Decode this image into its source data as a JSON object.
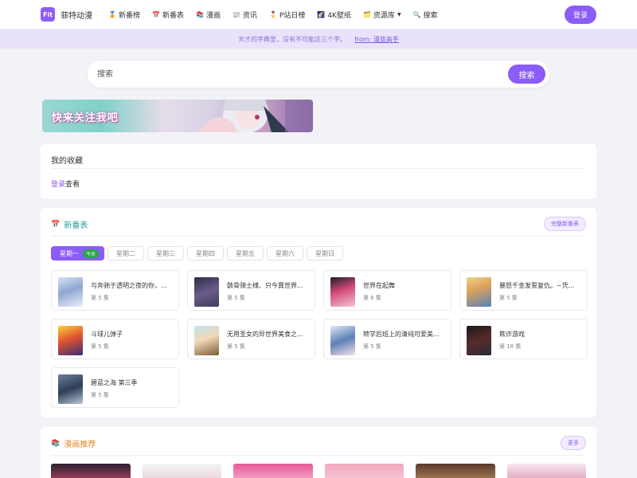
{
  "header": {
    "logo_text": "Fit",
    "brand": "菲特动漫",
    "nav": [
      {
        "icon": "🏅",
        "label": "新番榜"
      },
      {
        "icon": "📅",
        "label": "新番表"
      },
      {
        "icon": "📚",
        "label": "漫画"
      },
      {
        "icon": "📰",
        "label": "资讯"
      },
      {
        "icon": "🎖️",
        "label": "P站日榜"
      },
      {
        "icon": "🌠",
        "label": "4K壁纸"
      },
      {
        "icon": "🗂️",
        "label": "资源库"
      },
      {
        "icon": "🔍",
        "label": "搜索"
      }
    ],
    "login": "登录"
  },
  "quote": {
    "text": "天才的字典里，没有不可能这三个字。",
    "from": "from: 漫篮高手"
  },
  "search": {
    "placeholder": "搜索",
    "button": "搜索"
  },
  "banner": {
    "text": "快来关注我吧"
  },
  "favorites": {
    "title": "我的收藏",
    "login_link": "登录",
    "suffix": "查看"
  },
  "schedule": {
    "icon": "📅",
    "title": "新番表",
    "full_button": "完整新番表",
    "days": [
      "星期一",
      "星期二",
      "星期三",
      "星期四",
      "星期五",
      "星期六",
      "星期日"
    ],
    "active_day": 0,
    "today_badge": "今天",
    "items": [
      {
        "title": "与奔驰于透明之夜的你，...",
        "episode": "第 5 集"
      },
      {
        "title": "骸骨骑士様、只今異世界...",
        "episode": "第 5 集"
      },
      {
        "title": "世界在起舞",
        "episode": "第 6 集"
      },
      {
        "title": "暴怒千金发誓复仇。~凭...",
        "episode": "第 5 集"
      },
      {
        "title": "斗球儿弹子",
        "episode": "第 5 集"
      },
      {
        "title": "无用圣女的异世界美食之...",
        "episode": "第 5 集"
      },
      {
        "title": "转学后班上的清纯可爱美...",
        "episode": "第 5 集"
      },
      {
        "title": "欺诈游戏",
        "episode": "第 18 集"
      },
      {
        "title": "碧蓝之海 第三季",
        "episode": "第 5 集"
      }
    ]
  },
  "manga": {
    "icon": "📚",
    "title": "漫画推荐",
    "more_button": "更多"
  },
  "colors": {
    "accent": "#8b5cf6",
    "today_badge": "#28a745",
    "schedule_title": "#2a9d9a",
    "manga_title": "#e08a28"
  }
}
